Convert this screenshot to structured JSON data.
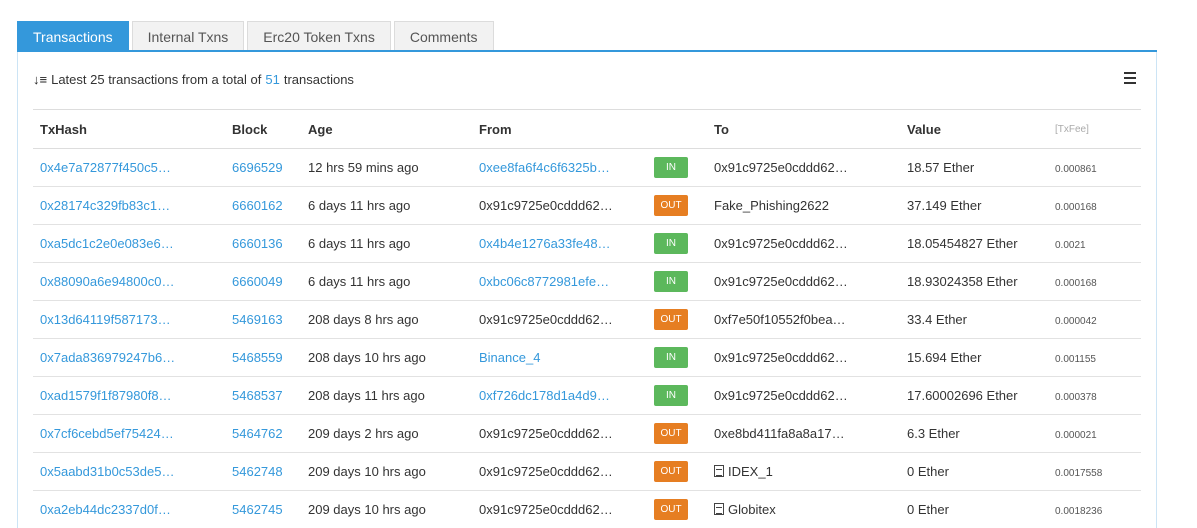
{
  "tabs": [
    {
      "label": "Transactions"
    },
    {
      "label": "Internal Txns"
    },
    {
      "label": "Erc20 Token Txns"
    },
    {
      "label": "Comments"
    }
  ],
  "summary": {
    "prefix": "Latest 25 transactions from a total of",
    "total": "51",
    "suffix": "transactions"
  },
  "table": {
    "headers": {
      "txhash": "TxHash",
      "block": "Block",
      "age": "Age",
      "from": "From",
      "to": "To",
      "value": "Value",
      "fee": "[TxFee]"
    },
    "rows": [
      {
        "txhash": "0x4e7a72877f450c5…",
        "block": "6696529",
        "age": "12 hrs 59 mins ago",
        "from": "0xee8fa6f4c6f6325b…",
        "from_link": true,
        "dir": "IN",
        "to": "0x91c9725e0cddd62…",
        "to_link": false,
        "to_contract": false,
        "value": "18.57 Ether",
        "fee": "0.000861"
      },
      {
        "txhash": "0x28174c329fb83c1…",
        "block": "6660162",
        "age": "6 days 11 hrs ago",
        "from": "0x91c9725e0cddd62…",
        "from_link": false,
        "dir": "OUT",
        "to": "Fake_Phishing2622",
        "to_link": true,
        "to_contract": false,
        "value": "37.149 Ether",
        "fee": "0.000168"
      },
      {
        "txhash": "0xa5dc1c2e0e083e6…",
        "block": "6660136",
        "age": "6 days 11 hrs ago",
        "from": "0x4b4e1276a33fe48…",
        "from_link": true,
        "dir": "IN",
        "to": "0x91c9725e0cddd62…",
        "to_link": false,
        "to_contract": false,
        "value": "18.05454827 Ether",
        "fee": "0.0021"
      },
      {
        "txhash": "0x88090a6e94800c0…",
        "block": "6660049",
        "age": "6 days 11 hrs ago",
        "from": "0xbc06c8772981efe…",
        "from_link": true,
        "dir": "IN",
        "to": "0x91c9725e0cddd62…",
        "to_link": false,
        "to_contract": false,
        "value": "18.93024358 Ether",
        "fee": "0.000168"
      },
      {
        "txhash": "0x13d64119f587173…",
        "block": "5469163",
        "age": "208 days 8 hrs ago",
        "from": "0x91c9725e0cddd62…",
        "from_link": false,
        "dir": "OUT",
        "to": "0xf7e50f10552f0bea…",
        "to_link": true,
        "to_contract": false,
        "value": "33.4 Ether",
        "fee": "0.000042"
      },
      {
        "txhash": "0x7ada836979247b6…",
        "block": "5468559",
        "age": "208 days 10 hrs ago",
        "from": "Binance_4",
        "from_link": true,
        "dir": "IN",
        "to": "0x91c9725e0cddd62…",
        "to_link": false,
        "to_contract": false,
        "value": "15.694 Ether",
        "fee": "0.001155"
      },
      {
        "txhash": "0xad1579f1f87980f8…",
        "block": "5468537",
        "age": "208 days 11 hrs ago",
        "from": "0xf726dc178d1a4d9…",
        "from_link": true,
        "dir": "IN",
        "to": "0x91c9725e0cddd62…",
        "to_link": false,
        "to_contract": false,
        "value": "17.60002696 Ether",
        "fee": "0.000378"
      },
      {
        "txhash": "0x7cf6cebd5ef75424…",
        "block": "5464762",
        "age": "209 days 2 hrs ago",
        "from": "0x91c9725e0cddd62…",
        "from_link": false,
        "dir": "OUT",
        "to": "0xe8bd411fa8a8a17…",
        "to_link": true,
        "to_contract": false,
        "value": "6.3 Ether",
        "fee": "0.000021"
      },
      {
        "txhash": "0x5aabd31b0c53de5…",
        "block": "5462748",
        "age": "209 days 10 hrs ago",
        "from": "0x91c9725e0cddd62…",
        "from_link": false,
        "dir": "OUT",
        "to": "IDEX_1",
        "to_link": true,
        "to_contract": true,
        "value": "0 Ether",
        "fee": "0.0017558"
      },
      {
        "txhash": "0xa2eb44dc2337d0f…",
        "block": "5462745",
        "age": "209 days 10 hrs ago",
        "from": "0x91c9725e0cddd62…",
        "from_link": false,
        "dir": "OUT",
        "to": "Globitex",
        "to_link": true,
        "to_contract": true,
        "value": "0 Ether",
        "fee": "0.0018236"
      }
    ]
  },
  "colors": {
    "accent": "#3498db",
    "in_badge": "#5cb85c",
    "out_badge": "#e67e22"
  },
  "icons": {
    "sort": "sort-amount-down-icon",
    "menu": "hamburger-menu-icon",
    "contract": "document-icon"
  }
}
